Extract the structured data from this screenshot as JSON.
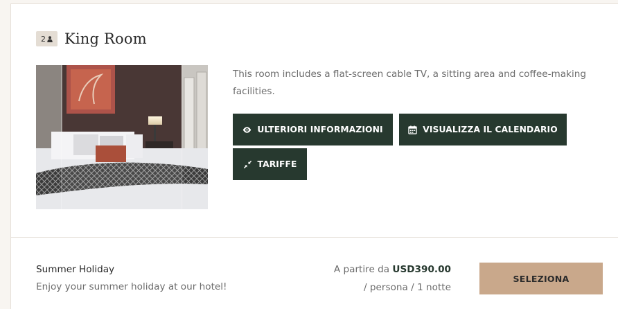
{
  "room": {
    "occupancy": "2",
    "title": "King Room",
    "description": "This room includes a flat-screen cable TV, a sitting area and coffee-making facilities.",
    "buttons": {
      "more_info": "ULTERIORI INFORMAZIONI",
      "calendar": "VISUALIZZA IL CALENDARIO",
      "rates": "TARIFFE"
    }
  },
  "rate": {
    "name": "Summer Holiday",
    "description": "Enjoy your summer holiday at our hotel!",
    "price_prefix": "A partire da",
    "price": "USD390.00",
    "price_unit": "/ persona / 1 notte",
    "select_label": "SELEZIONA"
  },
  "icons": {
    "occupancy": "person-icon",
    "more_info": "eye-icon",
    "calendar": "calendar-icon",
    "rates": "compress-arrows-icon"
  },
  "colors": {
    "primary_button": "#27392f",
    "select_button": "#c9a88b",
    "badge": "#e4ddd4"
  }
}
